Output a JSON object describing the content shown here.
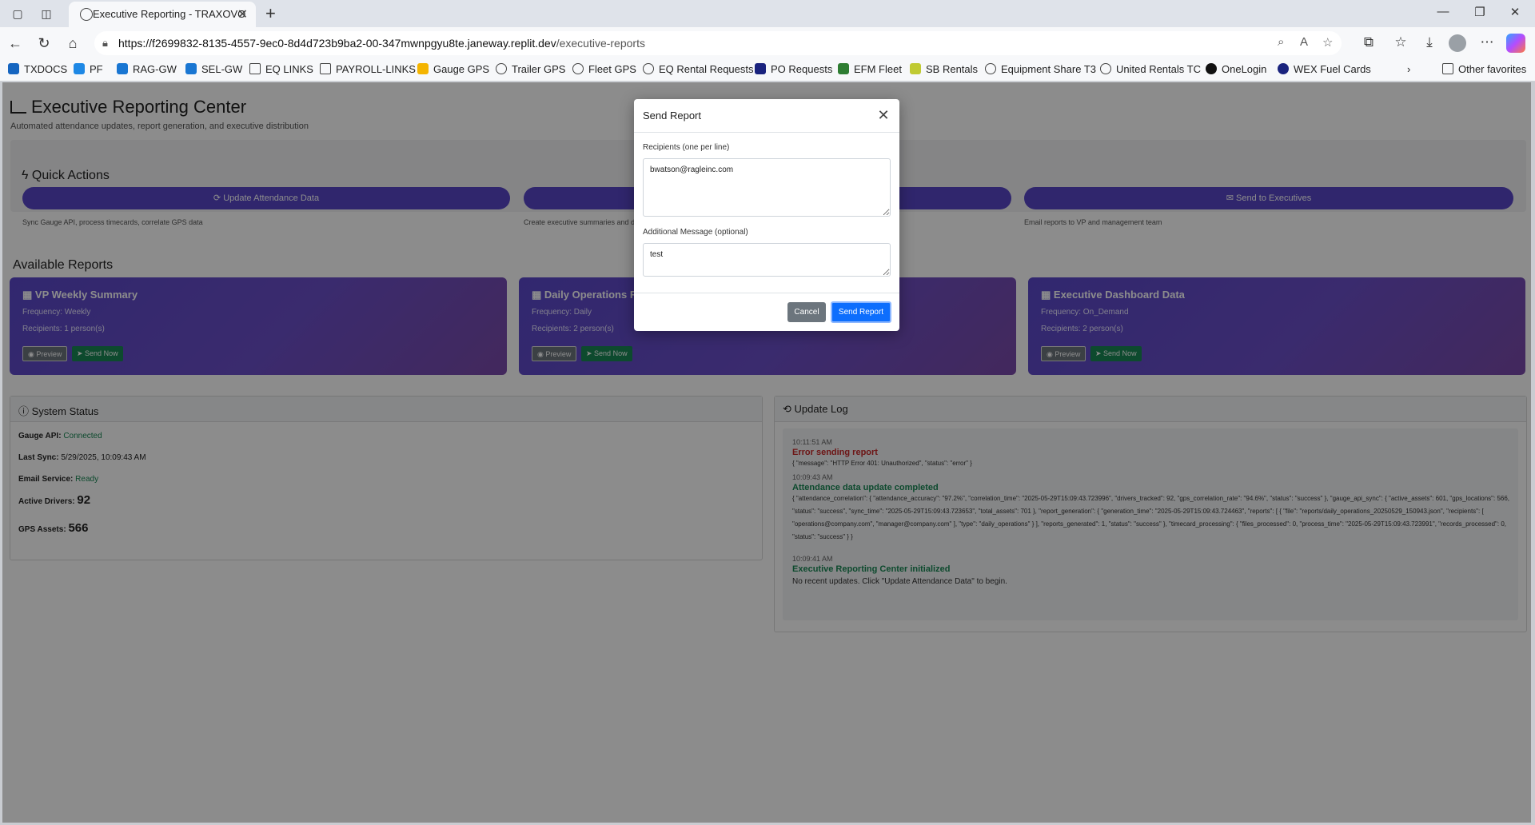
{
  "browser": {
    "tab_title": "Executive Reporting - TRAXOVO",
    "url_host": "https://f2699832-8135-4557-9ec0-8d4d723b9ba2-00-347mwnpgyu8te.janeway.replit.dev",
    "url_path": "/executive-reports",
    "bookmarks": [
      "TXDOCS",
      "PF",
      "RAG-GW",
      "SEL-GW",
      "EQ LINKS",
      "PAYROLL-LINKS",
      "Gauge GPS",
      "Trailer GPS",
      "Fleet GPS",
      "EQ Rental Requests",
      "PO Requests",
      "EFM Fleet",
      "SB Rentals",
      "Equipment Share T3",
      "United Rentals TC",
      "OneLogin",
      "WEX Fuel Cards"
    ],
    "other_favorites": "Other favorites"
  },
  "page": {
    "title": "Executive Reporting Center",
    "subtitle": "Automated attendance updates, report generation, and executive distribution"
  },
  "quick_actions": {
    "heading": "Quick Actions",
    "items": [
      {
        "label": "Update Attendance Data",
        "desc": "Sync Gauge API, process timecards, correlate GPS data"
      },
      {
        "label": "",
        "desc": "Create executive summaries and d"
      },
      {
        "label": "Send to Executives",
        "desc": "Email reports to VP and management team"
      }
    ]
  },
  "reports": {
    "heading": "Available Reports",
    "items": [
      {
        "title": "VP Weekly Summary",
        "frequency": "Frequency: Weekly",
        "recipients": "Recipients: 1 person(s)",
        "preview": "Preview",
        "send": "Send Now"
      },
      {
        "title": "Daily Operations R",
        "frequency": "Frequency: Daily",
        "recipients": "Recipients: 2 person(s)",
        "preview": "Preview",
        "send": "Send Now"
      },
      {
        "title": "Executive Dashboard Data",
        "frequency": "Frequency: On_Demand",
        "recipients": "Recipients: 2 person(s)",
        "preview": "Preview",
        "send": "Send Now"
      }
    ]
  },
  "system_status": {
    "heading": "System Status",
    "gauge_label": "Gauge API:",
    "gauge_value": "Connected",
    "sync_label": "Last Sync:",
    "sync_value": "5/29/2025, 10:09:43 AM",
    "email_label": "Email Service:",
    "email_value": "Ready",
    "drivers_label": "Active Drivers:",
    "drivers_value": "92",
    "assets_label": "GPS Assets:",
    "assets_value": "566"
  },
  "update_log": {
    "heading": "Update Log",
    "entries": [
      {
        "time": "10:11:51 AM",
        "title": "Error sending report",
        "body": "{ \"message\": \"HTTP Error 401: Unauthorized\", \"status\": \"error\" }"
      },
      {
        "time": "10:09:43 AM",
        "title": "Attendance data update completed",
        "body": "{ \"attendance_correlation\": { \"attendance_accuracy\": \"97.2%\", \"correlation_time\": \"2025-05-29T15:09:43.723996\", \"drivers_tracked\": 92, \"gps_correlation_rate\": \"94.6%\", \"status\": \"success\" }, \"gauge_api_sync\": { \"active_assets\": 601, \"gps_locations\": 566, \"status\": \"success\", \"sync_time\": \"2025-05-29T15:09:43.723653\", \"total_assets\": 701 }, \"report_generation\": { \"generation_time\": \"2025-05-29T15:09:43.724463\", \"reports\": [ { \"file\": \"reports/daily_operations_20250529_150943.json\", \"recipients\": [ \"operations@company.com\", \"manager@company.com\" ], \"type\": \"daily_operations\" } ], \"reports_generated\": 1, \"status\": \"success\" }, \"timecard_processing\": { \"files_processed\": 0, \"process_time\": \"2025-05-29T15:09:43.723991\", \"records_processed\": 0, \"status\": \"success\" } }"
      },
      {
        "time": "10:09:41 AM",
        "title": "Executive Reporting Center initialized",
        "body": "No recent updates. Click \"Update Attendance Data\" to begin."
      }
    ]
  },
  "modal": {
    "title": "Send Report",
    "recipients_label": "Recipients (one per line)",
    "recipients_value": "bwatson@ragleinc.com",
    "message_label": "Additional Message (optional)",
    "message_value": "test",
    "cancel": "Cancel",
    "send": "Send Report"
  },
  "colors": {
    "accent": "#0d6efd",
    "card_purple": "#5a48ca",
    "success": "#198754",
    "error": "#c62828"
  }
}
